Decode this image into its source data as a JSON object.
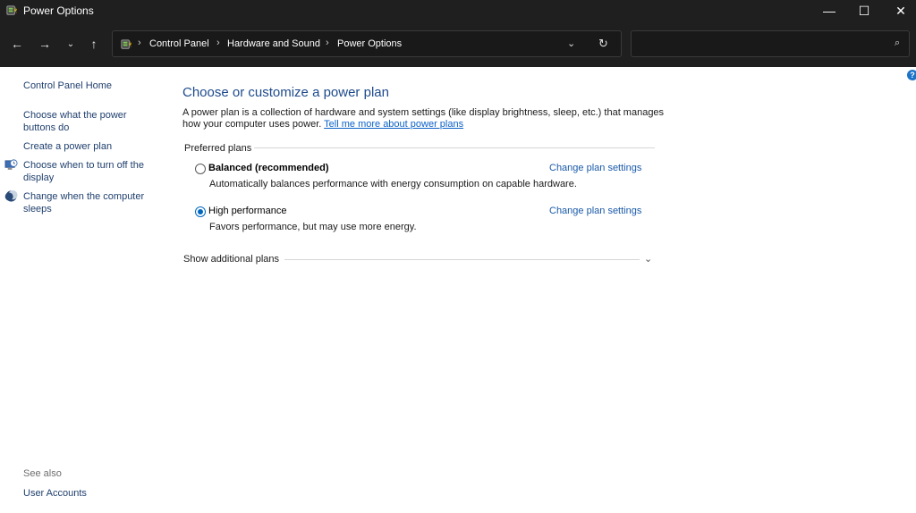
{
  "window": {
    "title": "Power Options",
    "minimize_icon": "—",
    "maximize_icon": "☐",
    "close_icon": "✕"
  },
  "nav": {
    "back_icon": "←",
    "forward_icon": "→",
    "recent_icon": "⌄",
    "up_icon": "↑",
    "breadcrumbs": [
      "Control Panel",
      "Hardware and Sound",
      "Power Options"
    ],
    "separator": "›",
    "dropdown_icon": "⌄",
    "refresh_icon": "↻",
    "search_placeholder": "",
    "search_icon": "⌕"
  },
  "help_icon": "?",
  "sidebar": {
    "home": "Control Panel Home",
    "items": [
      {
        "label_line1": "Choose what the power",
        "label_line2": "buttons do"
      },
      {
        "label_line1": "Create a power plan",
        "label_line2": ""
      },
      {
        "label_line1": "Choose when to turn off the",
        "label_line2": "display"
      },
      {
        "label_line1": "Change when the computer",
        "label_line2": "sleeps"
      }
    ],
    "see_also_title": "See also",
    "see_also_items": [
      "User Accounts"
    ]
  },
  "main": {
    "title": "Choose or customize a power plan",
    "description_line1": "A power plan is a collection of hardware and system settings (like display brightness, sleep, etc.) that manages",
    "description_line2": "how your computer uses power.",
    "learn_more": "Tell me more about power plans",
    "preferred_plans_label": "Preferred plans",
    "plans": [
      {
        "name": "Balanced (recommended)",
        "description": "Automatically balances performance with energy consumption on capable hardware.",
        "selected": false,
        "change_link": "Change plan settings"
      },
      {
        "name": "High performance",
        "description": "Favors performance, but may use more energy.",
        "selected": true,
        "change_link": "Change plan settings"
      }
    ],
    "show_additional_plans": "Show additional plans",
    "expand_icon": "⌄"
  },
  "colors": {
    "titlebar_bg": "#1f1f1f",
    "link": "#1a5aa8",
    "heading": "#1e4a8c",
    "radio_selected": "#0067c0"
  }
}
